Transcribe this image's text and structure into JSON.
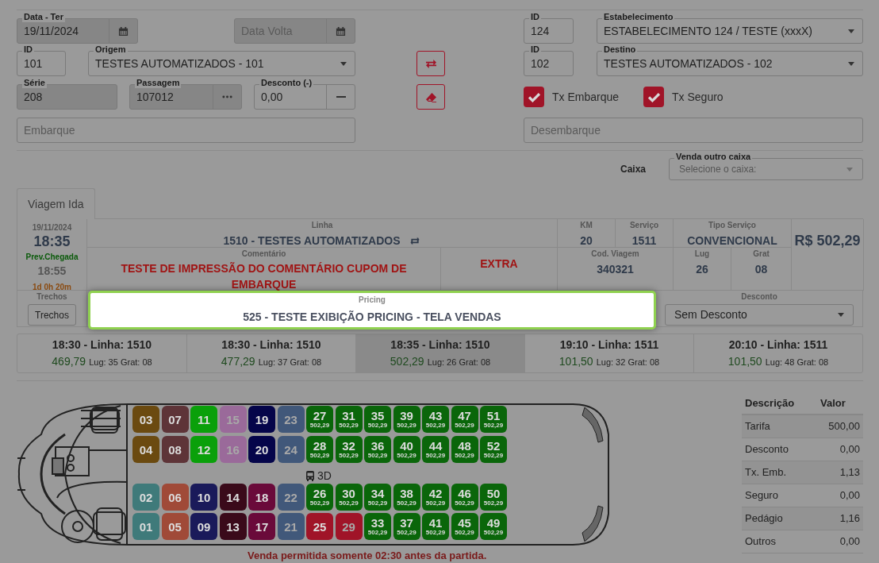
{
  "form": {
    "data": {
      "label": "Data - Ter",
      "value": "19/11/2024",
      "disabled": true
    },
    "data_volta": {
      "placeholder": "Data Volta",
      "disabled": true
    },
    "estabelecimento_id": {
      "label": "ID",
      "value": "124"
    },
    "estabelecimento": {
      "label": "Estabelecimento",
      "value": "ESTABELECIMENTO 124 / TESTE (xxxX)"
    },
    "origem_id": {
      "label": "ID",
      "value": "101"
    },
    "origem": {
      "label": "Origem",
      "value": "TESTES AUTOMATIZADOS - 101"
    },
    "destino_id": {
      "label": "ID",
      "value": "102"
    },
    "destino": {
      "label": "Destino",
      "value": "TESTES AUTOMATIZADOS - 102"
    },
    "serie": {
      "label": "Série",
      "value": "208",
      "disabled": true
    },
    "passagem": {
      "label": "Passagem",
      "value": "107012",
      "disabled": true
    },
    "desconto": {
      "label": "Desconto (-)",
      "value": "0,00"
    },
    "checkboxes": [
      {
        "label": "Tx Embarque",
        "checked": true
      },
      {
        "label": "Tx Seguro",
        "checked": true
      }
    ],
    "embarque": {
      "placeholder": "Embarque"
    },
    "desembarque": {
      "placeholder": "Desembarque"
    }
  },
  "caixa": {
    "label": "Caixa",
    "select_label": "Venda outro caixa",
    "placeholder": "Selecione o caixa:"
  },
  "tabs": [
    {
      "label": "Viagem Ida",
      "selected": true
    }
  ],
  "trip": {
    "date": "19/11/2024",
    "time": "18:35",
    "arrival_label": "Prev.Chegada",
    "arrival_time": "18:55",
    "duration": "1d 0h 20m",
    "linha_label": "Linha",
    "linha": "1510 - TESTES AUTOMATIZADOS",
    "km_label": "KM",
    "km": "20",
    "servico_label": "Serviço",
    "servico": "1511",
    "tipo_label": "Tipo Serviço",
    "tipo": "CONVENCIONAL",
    "price": "R$ 502,29",
    "comentario_label": "Comentário",
    "comentario": "TESTE DE IMPRESSÃO DO COMENTÁRIO CUPOM DE EMBARQUE",
    "extra": "EXTRA",
    "cod_label": "Cod. Viagem",
    "cod": "340321",
    "lug_label": "Lug",
    "lug": "26",
    "grat_label": "Grat",
    "grat": "08",
    "trechos_label": "Trechos",
    "trechos_button": "Trechos",
    "pricing_label": "Pricing",
    "pricing": "525 - TESTE EXIBIÇÃO PRICING - TELA VENDAS",
    "desconto_label": "Desconto",
    "desconto": "Sem Desconto"
  },
  "trip_options": [
    {
      "title": "18:30 - Linha: 1510",
      "price": "469,79",
      "details": "Lug: 35 Grat: 08",
      "selected": false
    },
    {
      "title": "18:30 - Linha: 1510",
      "price": "477,29",
      "details": "Lug: 37 Grat: 08",
      "selected": false
    },
    {
      "title": "18:35 - Linha: 1510",
      "price": "502,29",
      "details": "Lug: 26 Grat: 08",
      "selected": true
    },
    {
      "title": "19:10 - Linha: 1511",
      "price": "101,50",
      "details": "Lug: 32 Grat: 08",
      "selected": false
    },
    {
      "title": "20:10 - Linha: 1511",
      "price": "101,50",
      "details": "Lug: 48 Grat: 08",
      "selected": false
    }
  ],
  "seat_rows": [
    [
      {
        "number": "03",
        "color": "#6b4a10"
      },
      {
        "number": "07",
        "color": "#5e3438"
      },
      {
        "number": "11",
        "color": "#0aa00a"
      },
      {
        "number": "15",
        "color": "#9a6a9a",
        "faded": true
      },
      {
        "number": "19",
        "color": "#05054a"
      },
      {
        "number": "23",
        "color": "#41587a",
        "faded": true
      },
      {
        "number": "27",
        "color": "#0a660a",
        "price": "502,29"
      },
      {
        "number": "31",
        "color": "#0a660a",
        "price": "502,29"
      },
      {
        "number": "35",
        "color": "#0a660a",
        "price": "502,29"
      },
      {
        "number": "39",
        "color": "#0a660a",
        "price": "502,29"
      },
      {
        "number": "43",
        "color": "#0a660a",
        "price": "502,29"
      },
      {
        "number": "47",
        "color": "#0a660a",
        "price": "502,29"
      },
      {
        "number": "51",
        "color": "#0a660a",
        "price": "502,29"
      }
    ],
    [
      {
        "number": "04",
        "color": "#6b4a10"
      },
      {
        "number": "08",
        "color": "#5e3438"
      },
      {
        "number": "12",
        "color": "#0aa00a"
      },
      {
        "number": "16",
        "color": "#9a6a9a",
        "faded": true
      },
      {
        "number": "20",
        "color": "#05054a"
      },
      {
        "number": "24",
        "color": "#41587a",
        "faded": true
      },
      {
        "number": "28",
        "color": "#0a660a",
        "price": "502,29"
      },
      {
        "number": "32",
        "color": "#0a660a",
        "price": "502,29"
      },
      {
        "number": "36",
        "color": "#0a660a",
        "price": "502,29"
      },
      {
        "number": "40",
        "color": "#0a660a",
        "price": "502,29"
      },
      {
        "number": "44",
        "color": "#0a660a",
        "price": "502,29"
      },
      {
        "number": "48",
        "color": "#0a660a",
        "price": "502,29"
      },
      {
        "number": "52",
        "color": "#0a660a",
        "price": "502,29"
      }
    ],
    [
      {
        "number": "02",
        "color": "#3f7a7a"
      },
      {
        "number": "06",
        "color": "#a04a38"
      },
      {
        "number": "10",
        "color": "#1a1a5a"
      },
      {
        "number": "14",
        "color": "#3a0a1a"
      },
      {
        "number": "18",
        "color": "#6a0a3a"
      },
      {
        "number": "22",
        "color": "#41587a",
        "faded": true
      },
      {
        "number": "26",
        "color": "#0a660a",
        "price": "502,29"
      },
      {
        "number": "30",
        "color": "#0a660a",
        "price": "502,29"
      },
      {
        "number": "34",
        "color": "#0a660a",
        "price": "502,29"
      },
      {
        "number": "38",
        "color": "#0a660a",
        "price": "502,29"
      },
      {
        "number": "42",
        "color": "#0a660a",
        "price": "502,29"
      },
      {
        "number": "46",
        "color": "#0a660a",
        "price": "502,29"
      },
      {
        "number": "50",
        "color": "#0a660a",
        "price": "502,29"
      }
    ],
    [
      {
        "number": "01",
        "color": "#3f7a7a"
      },
      {
        "number": "05",
        "color": "#a04a38"
      },
      {
        "number": "09",
        "color": "#1a1a5a"
      },
      {
        "number": "13",
        "color": "#3a0a1a"
      },
      {
        "number": "17",
        "color": "#6a0a3a"
      },
      {
        "number": "21",
        "color": "#41587a",
        "faded": true
      },
      {
        "number": "25",
        "color": "#a01428"
      },
      {
        "number": "29",
        "color": "#a01428",
        "faded": true
      },
      {
        "number": "33",
        "color": "#0a660a",
        "price": "502,29"
      },
      {
        "number": "37",
        "color": "#0a660a",
        "price": "502,29"
      },
      {
        "number": "41",
        "color": "#0a660a",
        "price": "502,29"
      },
      {
        "number": "45",
        "color": "#0a660a",
        "price": "502,29"
      },
      {
        "number": "49",
        "color": "#0a660a",
        "price": "502,29"
      }
    ]
  ],
  "bus_label": "3D",
  "warning": "Venda permitida somente 02:30 antes da partida.",
  "summary": {
    "columns": [
      "Descrição",
      "Valor"
    ],
    "rows": [
      {
        "description": "Tarifa",
        "value": "500,00"
      },
      {
        "description": "Desconto",
        "value": "0,00"
      },
      {
        "description": "Tx. Emb.",
        "value": "1,13"
      },
      {
        "description": "Seguro",
        "value": "0,00"
      },
      {
        "description": "Pedágio",
        "value": "1,16"
      },
      {
        "description": "Outros",
        "value": "0,00"
      }
    ]
  }
}
